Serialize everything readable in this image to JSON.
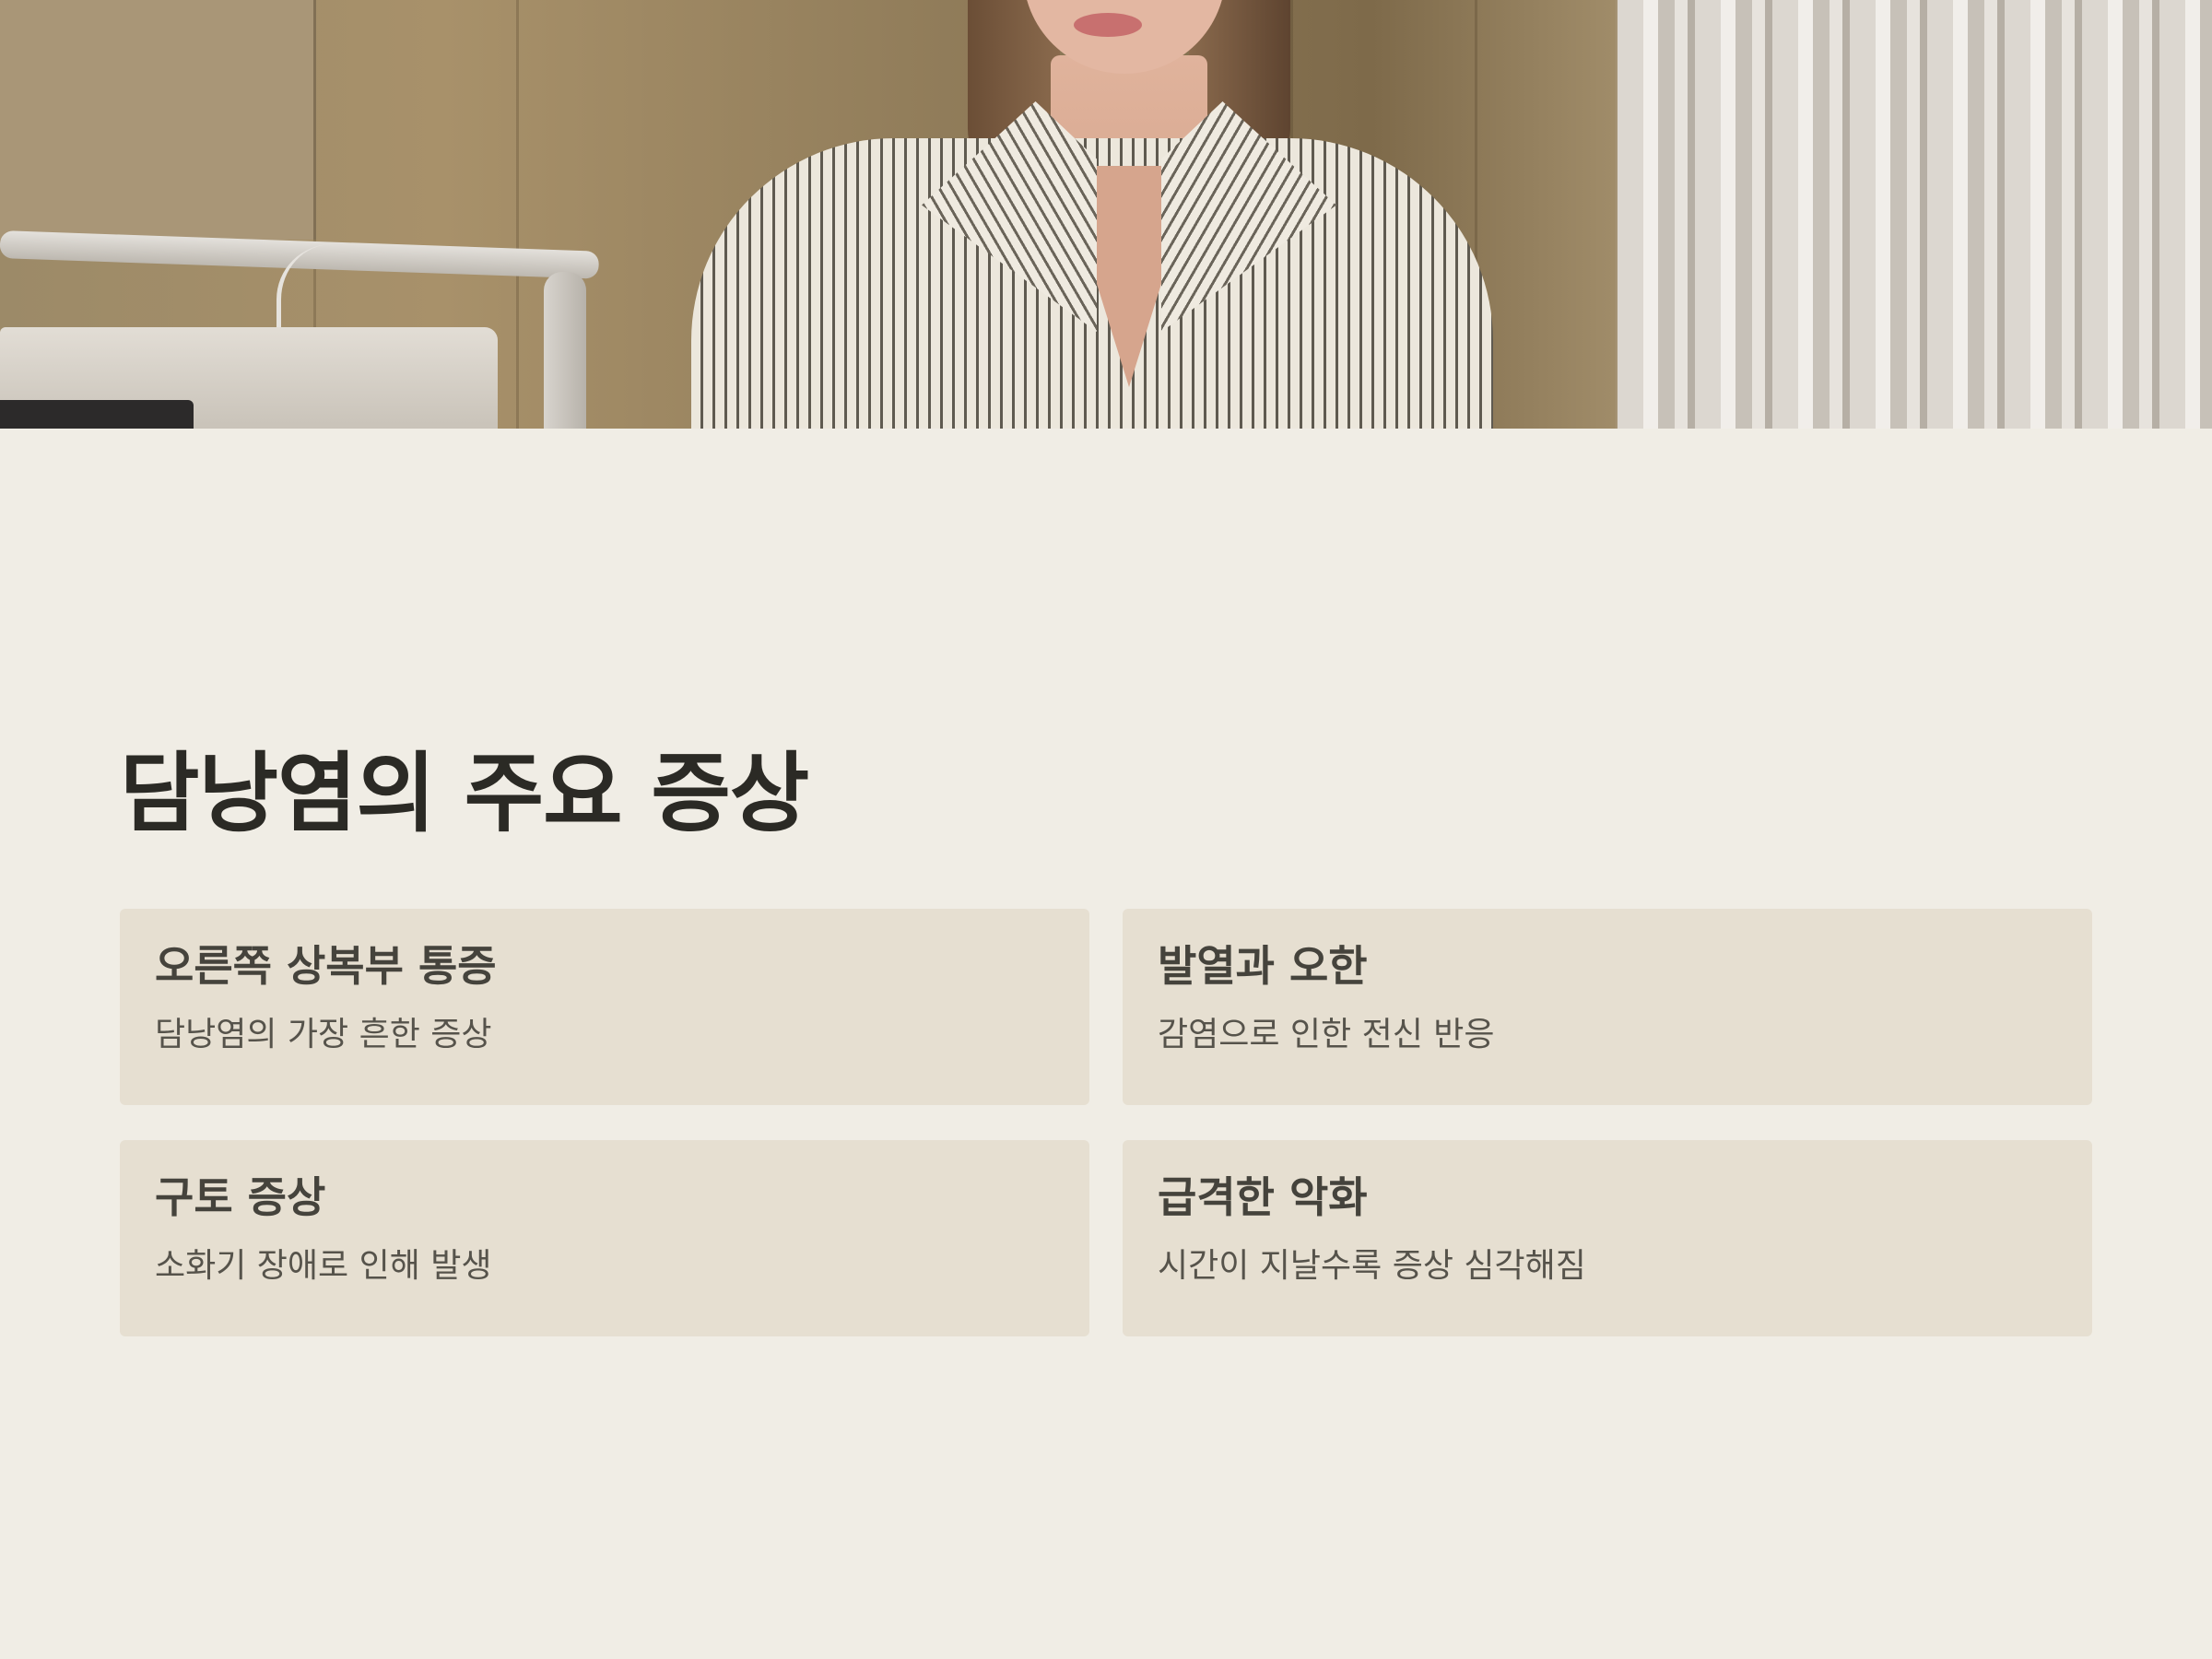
{
  "hero": {
    "icon": "hero-photo-patient-icon"
  },
  "page_title": "담낭염의 주요 증상",
  "cards": [
    {
      "title": "오른쪽 상복부 통증",
      "description": "담낭염의 가장 흔한 증상"
    },
    {
      "title": "발열과 오한",
      "description": "감염으로 인한 전신 반응"
    },
    {
      "title": "구토 증상",
      "description": "소화기 장애로 인해 발생"
    },
    {
      "title": "급격한 악화",
      "description": "시간이 지날수록 증상 심각해짐"
    }
  ],
  "colors": {
    "background": "#f0ede5",
    "card": "#e6dfd1",
    "title": "#2b2a25",
    "card_title": "#45433c",
    "card_text": "#56534b"
  }
}
